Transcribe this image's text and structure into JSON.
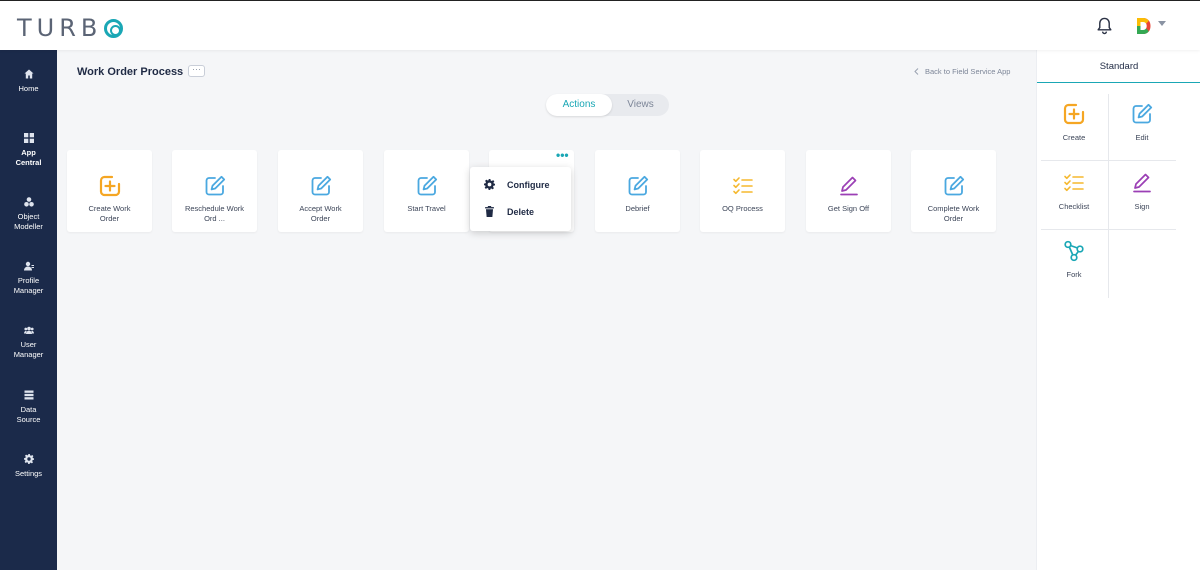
{
  "app": {
    "logo_text": "TURB",
    "logo_last": "O"
  },
  "sidebar": {
    "items": [
      {
        "label": "Home",
        "icon": "home-icon"
      },
      {
        "label": "App\nCentral",
        "icon": "grid-icon",
        "active": true
      },
      {
        "label": "Object\nModeller",
        "icon": "objects-icon"
      },
      {
        "label": "Profile\nManager",
        "icon": "profile-icon"
      },
      {
        "label": "User\nManager",
        "icon": "users-icon"
      },
      {
        "label": "Data\nSource",
        "icon": "database-icon"
      },
      {
        "label": "Settings",
        "icon": "gear-icon"
      }
    ]
  },
  "header": {
    "page_title": "Work Order Process",
    "more": "···",
    "back_link": "Back to Field Service App"
  },
  "toggle": {
    "actions": "Actions",
    "views": "Views"
  },
  "cards": [
    {
      "label": "Create Work\nOrder",
      "icon": "create-icon"
    },
    {
      "label": "Reschedule Work\nOrd ...",
      "icon": "edit-icon"
    },
    {
      "label": "Accept Work\nOrder",
      "icon": "edit-icon"
    },
    {
      "label": "Start Travel",
      "icon": "edit-icon"
    },
    {
      "label": "",
      "icon": ""
    },
    {
      "label": "Debrief",
      "icon": "edit-icon"
    },
    {
      "label": "OQ Process",
      "icon": "checklist-icon"
    },
    {
      "label": "Get Sign Off",
      "icon": "sign-icon"
    },
    {
      "label": "Complete Work\nOrder",
      "icon": "edit-icon"
    }
  ],
  "card_more": "•••",
  "context_menu": {
    "configure": "Configure",
    "delete": "Delete"
  },
  "right_panel": {
    "title": "Standard",
    "tiles": [
      {
        "label": "Create",
        "icon": "create-icon"
      },
      {
        "label": "Edit",
        "icon": "edit-icon"
      },
      {
        "label": "Checklist",
        "icon": "checklist-icon"
      },
      {
        "label": "Sign",
        "icon": "sign-icon"
      },
      {
        "label": "Fork",
        "icon": "fork-icon"
      }
    ]
  },
  "colors": {
    "accent": "#1aa7b5",
    "sidebar": "#1b2a4a",
    "create": "#f5a623",
    "edit": "#4aa8e0",
    "checklist": "#f5b82e",
    "sign": "#9b3fb5",
    "fork": "#1aa7b5"
  }
}
